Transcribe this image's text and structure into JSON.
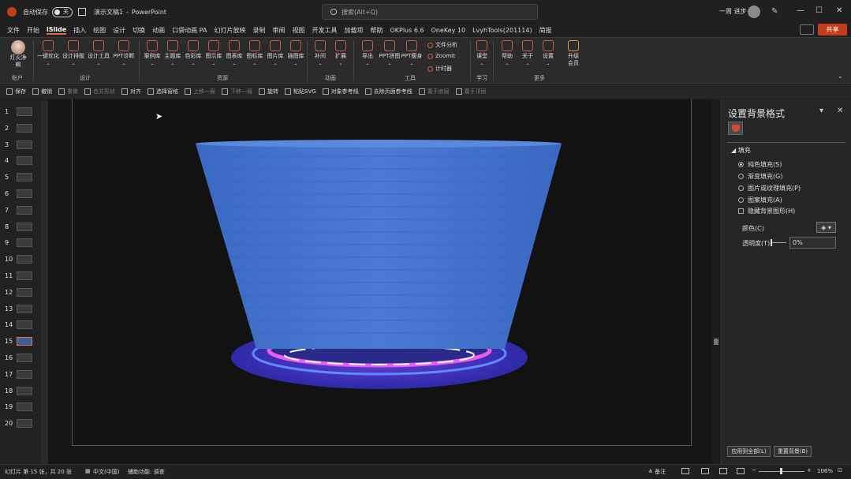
{
  "titlebar": {
    "autosave_label": "自动保存",
    "autosave_state": "关",
    "doc_title": "演示文稿1",
    "app": "PowerPoint",
    "search_placeholder": "搜索(Alt+Q)",
    "user": "一周 进步"
  },
  "menu": {
    "items": [
      "文件",
      "开始",
      "iSlide",
      "插入",
      "绘图",
      "设计",
      "切换",
      "动画",
      "口袋动画 PA",
      "幻灯片放映",
      "录制",
      "审阅",
      "视图",
      "开发工具",
      "加载项",
      "帮助",
      "OKPlus 6.6",
      "OneKey 10",
      "LvyhTools(201114)",
      "简报"
    ],
    "active": "iSlide",
    "share": "共享"
  },
  "ribbon": {
    "account": {
      "name": "灯火净\n蝎",
      "group": "账户"
    },
    "design": {
      "buttons": [
        "一键优化",
        "设计排版",
        "设计工具",
        "PPT诊断"
      ],
      "group": "设计"
    },
    "resources": {
      "buttons": [
        "案例库",
        "主题库",
        "色彩库",
        "图示库",
        "图表库",
        "图标库",
        "图片库",
        "插图库"
      ],
      "group": "资源"
    },
    "animation": {
      "buttons": [
        "补间",
        "扩展"
      ],
      "group": "动画"
    },
    "tools": {
      "buttons": [
        "导出",
        "PPT拼图",
        "PPT瘦身"
      ],
      "small": [
        "文件分析",
        "ZoomIt",
        "计时器"
      ],
      "group": "工具"
    },
    "learn": {
      "buttons": [
        "课堂"
      ],
      "group": "学习"
    },
    "more": {
      "buttons": [
        "帮助",
        "关于",
        "设置"
      ],
      "upgrade": "升级\n会员",
      "group": "更多"
    }
  },
  "qat": {
    "items": [
      {
        "label": "保存",
        "dim": false
      },
      {
        "label": "撤销",
        "dim": false
      },
      {
        "label": "重做",
        "dim": true
      },
      {
        "label": "合并形状",
        "dim": true
      },
      {
        "label": "对齐",
        "dim": false
      },
      {
        "label": "选择窗格",
        "dim": false
      },
      {
        "label": "上移一层",
        "dim": true
      },
      {
        "label": "下移一层",
        "dim": true
      },
      {
        "label": "旋转",
        "dim": false
      },
      {
        "label": "粘贴SVG",
        "dim": false
      },
      {
        "label": "对象参考线",
        "dim": false
      },
      {
        "label": "去除页面参考线",
        "dim": false
      },
      {
        "label": "置于底层",
        "dim": true
      },
      {
        "label": "置于顶层",
        "dim": true
      }
    ]
  },
  "thumbnails": {
    "numbers": [
      "1",
      "2",
      "3",
      "4",
      "5",
      "6",
      "7",
      "8",
      "9",
      "10",
      "11",
      "12",
      "13",
      "14",
      "15",
      "16",
      "17",
      "18",
      "19",
      "20"
    ],
    "selected": "15"
  },
  "pane": {
    "title": "设置背景格式",
    "section": "填充",
    "options": [
      "纯色填充(S)",
      "渐变填充(G)",
      "图片或纹理填充(P)",
      "图案填充(A)"
    ],
    "selected_option": "纯色填充(S)",
    "hide_bg": "隐藏背景图形(H)",
    "color_label": "颜色(C)",
    "transparency_label": "透明度(T)",
    "transparency_value": "0%",
    "apply_all": "应用到全部(L)",
    "reset": "重置背景(B)"
  },
  "status": {
    "slide_info": "幻灯片 第 15 张，共 20 张",
    "lang": "中文(中国)",
    "accessibility": "辅助功能: 调查",
    "notes": "备注",
    "zoom": "106%"
  },
  "colors": {
    "accent": "#c43e1c",
    "cup_top": "#4a7ad0",
    "cup_bottom": "#2f5fb5",
    "neon": "#e85cf0"
  }
}
